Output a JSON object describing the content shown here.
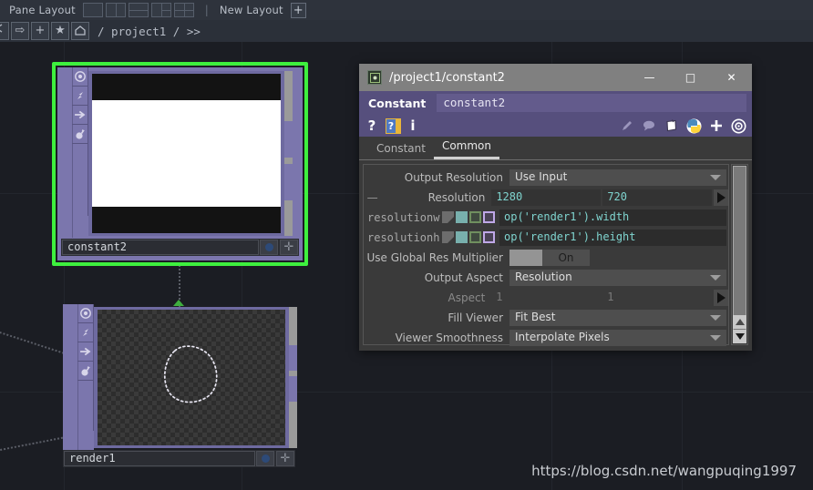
{
  "topbar": {
    "pane_layout_label": "Pane Layout",
    "separator": "|",
    "new_layout_label": "New Layout",
    "new_layout_plus": "+",
    "layout_buttons": [
      "single",
      "vertical-split",
      "horizontal-split",
      "three-pane",
      "quad-pane"
    ]
  },
  "pathbar": {
    "buttons": [
      "back-arrow",
      "forward-arrow",
      "plus",
      "star",
      "home"
    ],
    "forward_glyph": "⇨",
    "plus_glyph": "+",
    "star_glyph": "★",
    "path": "/ project1 / >>"
  },
  "nodes": [
    {
      "name": "constant2",
      "selected": true,
      "viewer_kind": "white-image",
      "flags": [
        "viewer-flag",
        "bypass-flag",
        "render-flag",
        "clone-flag"
      ],
      "footer_chips": [
        "node-color-dot",
        "node-expand-plus"
      ]
    },
    {
      "name": "render1",
      "selected": false,
      "viewer_kind": "checker-alpha",
      "flags": [
        "viewer-flag",
        "bypass-flag",
        "render-flag",
        "clone-flag"
      ],
      "footer_chips": [
        "node-color-dot",
        "node-expand-plus"
      ]
    }
  ],
  "dialog": {
    "title": "/project1/constant2",
    "window_buttons": {
      "minimize": "—",
      "maximize": "□",
      "close": "✕"
    },
    "op_type": "Constant",
    "op_name": "constant2",
    "help_icons": [
      "question-mark-icon",
      "help-book-icon",
      "info-icon"
    ],
    "tool_icons": [
      "pencil-icon",
      "comment-icon",
      "note-icon",
      "python-icon",
      "plus-icon",
      "target-icon"
    ],
    "help_glyphs": {
      "question": "?",
      "info": "i"
    },
    "tabs": [
      {
        "label": "Constant",
        "active": false
      },
      {
        "label": "Common",
        "active": true
      }
    ],
    "params": [
      {
        "kind": "menu",
        "label": "Output Resolution",
        "value": "Use Input"
      },
      {
        "kind": "resolution",
        "minus": "—",
        "label": "Resolution",
        "value_w": "1280",
        "value_h": "720"
      },
      {
        "kind": "expression",
        "name": "resolutionw",
        "value": "op('render1').width",
        "chips": [
          "constant-mode",
          "expression-mode",
          "export-mode",
          "bind-mode"
        ]
      },
      {
        "kind": "expression",
        "name": "resolutionh",
        "value": "op('render1').height",
        "chips": [
          "constant-mode",
          "expression-mode",
          "export-mode",
          "bind-mode"
        ]
      },
      {
        "kind": "toggle",
        "label": "Use Global Res Multiplier",
        "value": "On"
      },
      {
        "kind": "menu",
        "label": "Output Aspect",
        "value": "Resolution"
      },
      {
        "kind": "aspect",
        "label": "Aspect",
        "value_w": "1",
        "value_h": "1",
        "dim": true
      },
      {
        "kind": "menu",
        "label": "Fill Viewer",
        "value": "Fit Best"
      },
      {
        "kind": "menu",
        "label": "Viewer Smoothness",
        "value": "Interpolate Pixels"
      }
    ]
  },
  "watermark": "https://blog.csdn.net/wangpuqing1997"
}
